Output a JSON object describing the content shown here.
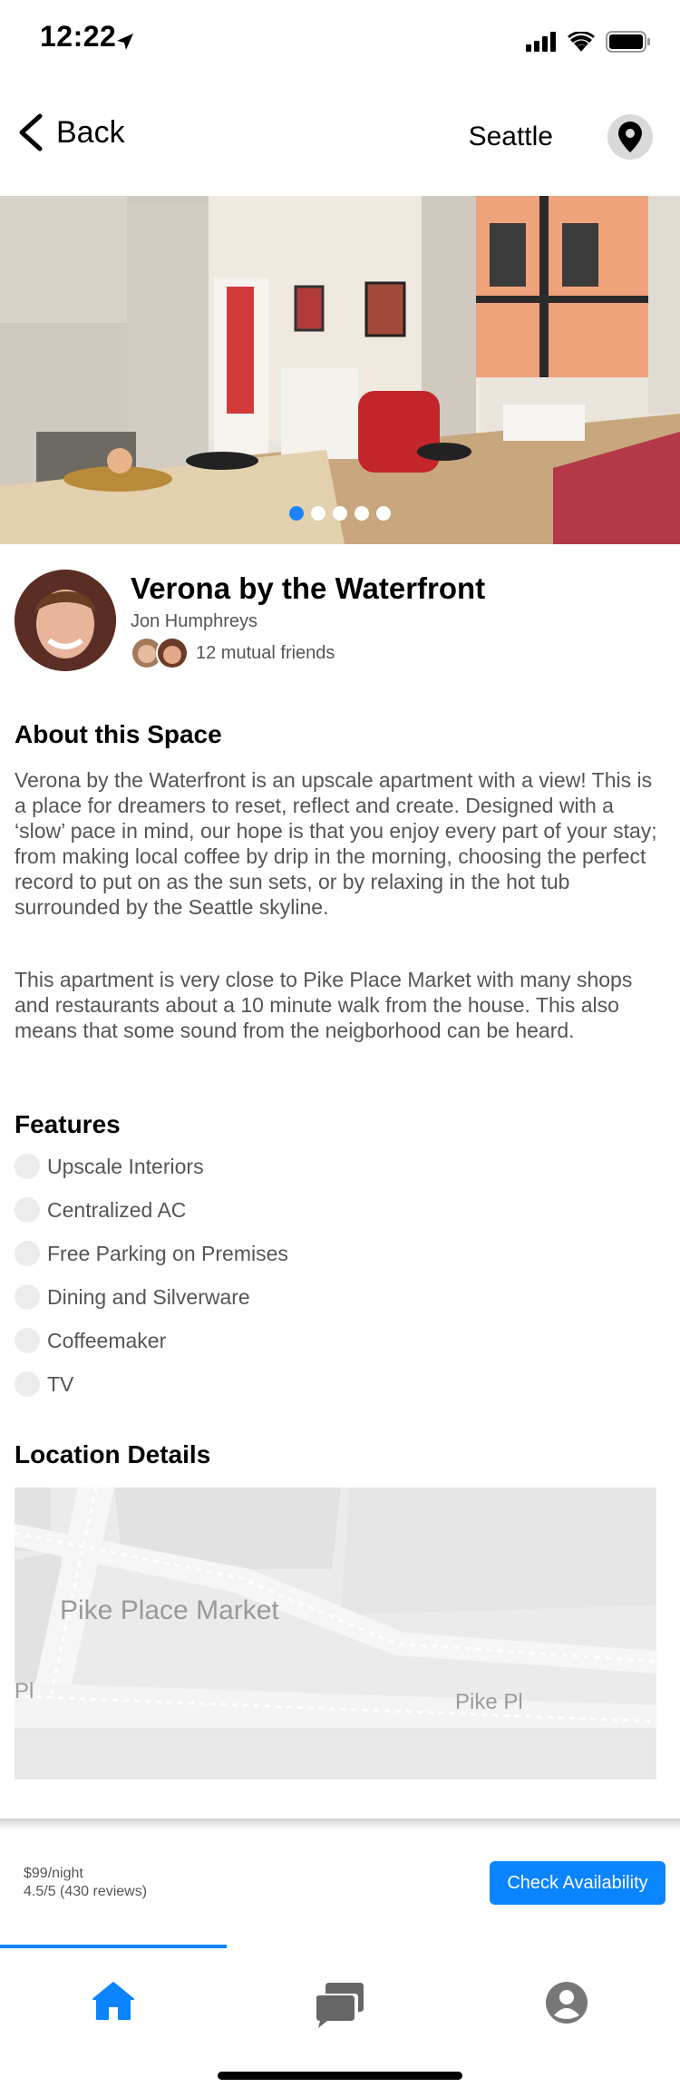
{
  "status_bar": {
    "time": "12:22"
  },
  "nav": {
    "back_label": "Back",
    "city": "Seattle"
  },
  "carousel": {
    "slide_count": 5,
    "active_index": 0
  },
  "listing": {
    "title": "Verona by the Waterfront",
    "host": "Jon Humphreys",
    "mutual_friends": "12 mutual friends"
  },
  "about": {
    "heading": "About this Space",
    "paragraphs": [
      "Verona by the Waterfront is an upscale apartment with a view! This is a place for dreamers to reset, reflect and create. Designed with a ‘slow’ pace in mind, our hope is that you enjoy every part of your stay; from making local coffee by drip in the morning, choosing the perfect record to put on as the sun sets, or by relaxing in the hot tub surrounded by the Seattle skyline.",
      "This apartment is very close to Pike Place Market with many shops and restaurants about a 10 minute walk from the house. This also means that some sound from the neigborhood can be heard."
    ]
  },
  "features": {
    "heading": "Features",
    "items": [
      "Upscale Interiors",
      "Centralized AC",
      "Free Parking on Premises",
      "Dining and Silverware",
      "Coffeemaker",
      "TV"
    ]
  },
  "location": {
    "heading": "Location Details",
    "map_labels": [
      "Pike Place Market",
      "Pl",
      "Pike Pl"
    ]
  },
  "booking": {
    "price": "$99/night",
    "rating": "4.5/5 (430 reviews)",
    "check_label": "Check Availability"
  },
  "tabbar": {
    "active": "home",
    "tabs": [
      "home-icon",
      "messages-icon",
      "profile-icon"
    ]
  },
  "colors": {
    "accent": "#0a84ff",
    "active_dot": "#1a84ff"
  }
}
